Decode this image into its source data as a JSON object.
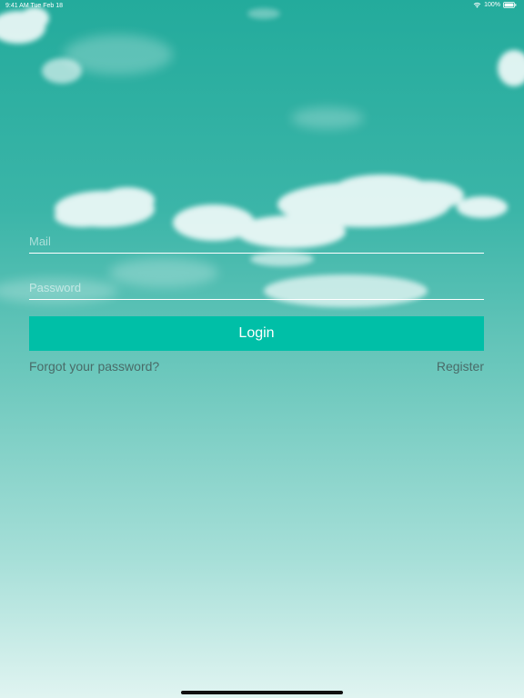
{
  "status_bar": {
    "time_date": "9:41 AM  Tue Feb 18",
    "battery": "100%",
    "icons": [
      "wifi-icon",
      "battery-icon"
    ]
  },
  "login_form": {
    "mail_placeholder": "Mail",
    "mail_value": "",
    "password_placeholder": "Password",
    "password_value": "",
    "login_label": "Login",
    "forgot_label": "Forgot your password?",
    "register_label": "Register"
  },
  "colors": {
    "accent": "#00bfa7",
    "background_top": "#23ab9c",
    "background_bottom": "#e0f4f1",
    "link_text": "#4a6b68"
  }
}
